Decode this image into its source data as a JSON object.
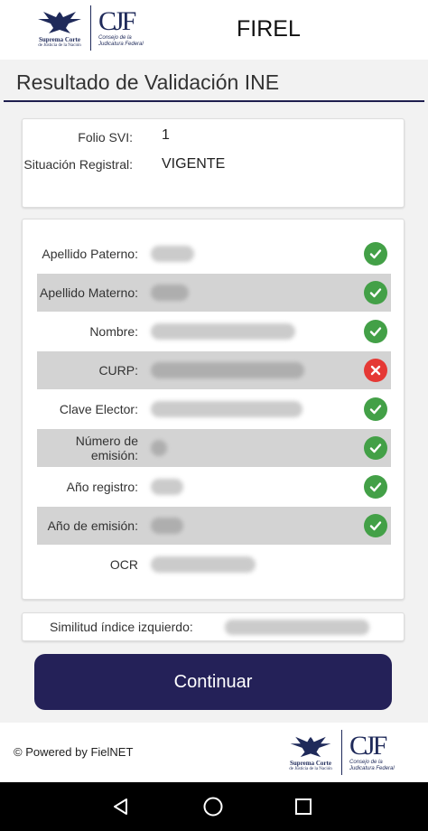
{
  "header": {
    "logo_sc": {
      "line1": "Suprema Corte",
      "line2": "de Justicia de la Nación"
    },
    "logo_cjf": {
      "mark": "CJF",
      "line1": "Consejo de la",
      "line2": "Judicatura Federal"
    },
    "app_title": "FIREL"
  },
  "page_title": "Resultado de Validación INE",
  "svi": {
    "folio_label": "Folio SVI:",
    "folio_value": "1",
    "situacion_label": "Situación Registral:",
    "situacion_value": "VIGENTE"
  },
  "fields": [
    {
      "label": "Apellido Paterno:",
      "status": "valid",
      "icon": "check-circle-icon"
    },
    {
      "label": "Apellido Materno:",
      "status": "valid",
      "icon": "check-circle-icon"
    },
    {
      "label": "Nombre:",
      "status": "valid",
      "icon": "check-circle-icon"
    },
    {
      "label": "CURP:",
      "status": "invalid",
      "icon": "x-circle-icon"
    },
    {
      "label": "Clave Elector:",
      "status": "valid",
      "icon": "check-circle-icon"
    },
    {
      "label": "Número de emisión:",
      "status": "valid",
      "icon": "check-circle-icon"
    },
    {
      "label": "Año registro:",
      "status": "valid",
      "icon": "check-circle-icon"
    },
    {
      "label": "Año de emisión:",
      "status": "valid",
      "icon": "check-circle-icon"
    },
    {
      "label": "OCR",
      "status": "none"
    }
  ],
  "similitud": {
    "label": "Similitud índice izquierdo:"
  },
  "continue_label": "Continuar",
  "footer": {
    "powered": "© Powered by FielNET"
  },
  "colors": {
    "primary": "#242158",
    "valid": "#43a047",
    "invalid": "#e53935",
    "shaded_row": "#d3d3d3"
  },
  "nav": {
    "icons": [
      "back-triangle-icon",
      "home-circle-icon",
      "recents-square-icon"
    ]
  }
}
